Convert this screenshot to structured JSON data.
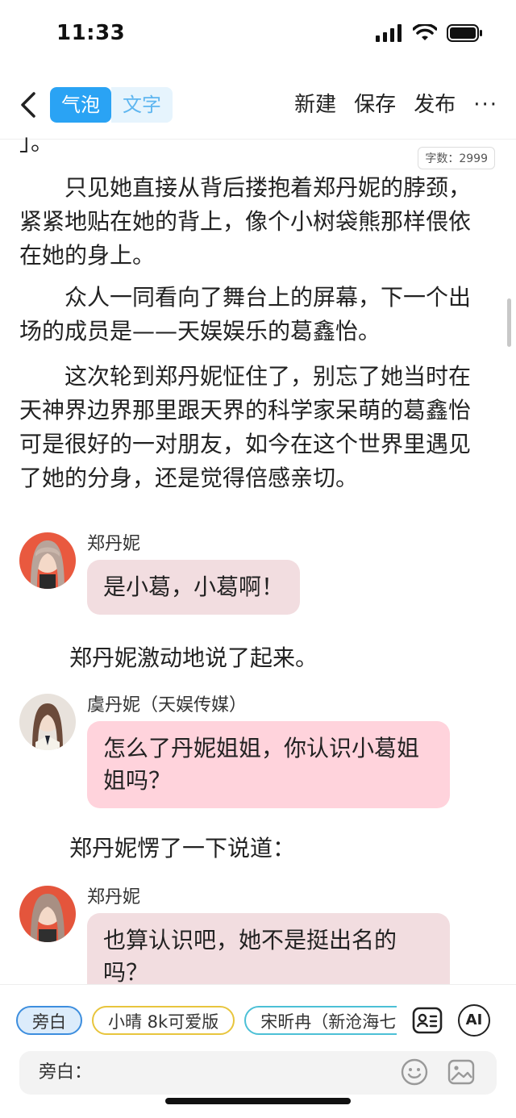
{
  "status": {
    "time": "11:33"
  },
  "nav": {
    "seg_bubble": "气泡",
    "seg_text": "文字",
    "new_label": "新建",
    "save_label": "保存",
    "publish_label": "发布",
    "more_label": "···"
  },
  "content": {
    "word_count": "字数：2999",
    "top_fragment": "」。",
    "paragraphs": [
      "只见她直接从背后搂抱着郑丹妮的脖颈，紧紧地贴在她的背上，像个小树袋熊那样偎依在她的身上。",
      "众人一同看向了舞台上的屏幕，下一个出场的成员是——天娱娱乐的葛鑫怡。",
      "这次轮到郑丹妮怔住了，别忘了她当时在天神界边界那里跟天界的科学家呆萌的葛鑫怡可是很好的一对朋友，如今在这个世界里遇见了她的分身，还是觉得倍感亲切。"
    ],
    "messages": [
      {
        "sender": "郑丹妮",
        "text": "是小葛，小葛啊！"
      },
      {
        "sender": "虞丹妮（天娱传媒）",
        "text": "怎么了丹妮姐姐，你认识小葛姐姐吗？"
      },
      {
        "sender": "郑丹妮",
        "text": "也算认识吧，她不是挺出名的吗？"
      }
    ],
    "narrations": [
      "郑丹妮激动地说了起来。",
      "郑丹妮愣了一下说道："
    ]
  },
  "bottom": {
    "chips": [
      "旁白",
      "小晴 8k可爱版",
      "宋昕冉（新沧海七"
    ],
    "ai_label": "AI",
    "input_label": "旁白："
  },
  "colors": {
    "accent": "#2aa3f4",
    "bubble_gray": "#f2dde0",
    "bubble_pink": "#ffd3dc"
  }
}
